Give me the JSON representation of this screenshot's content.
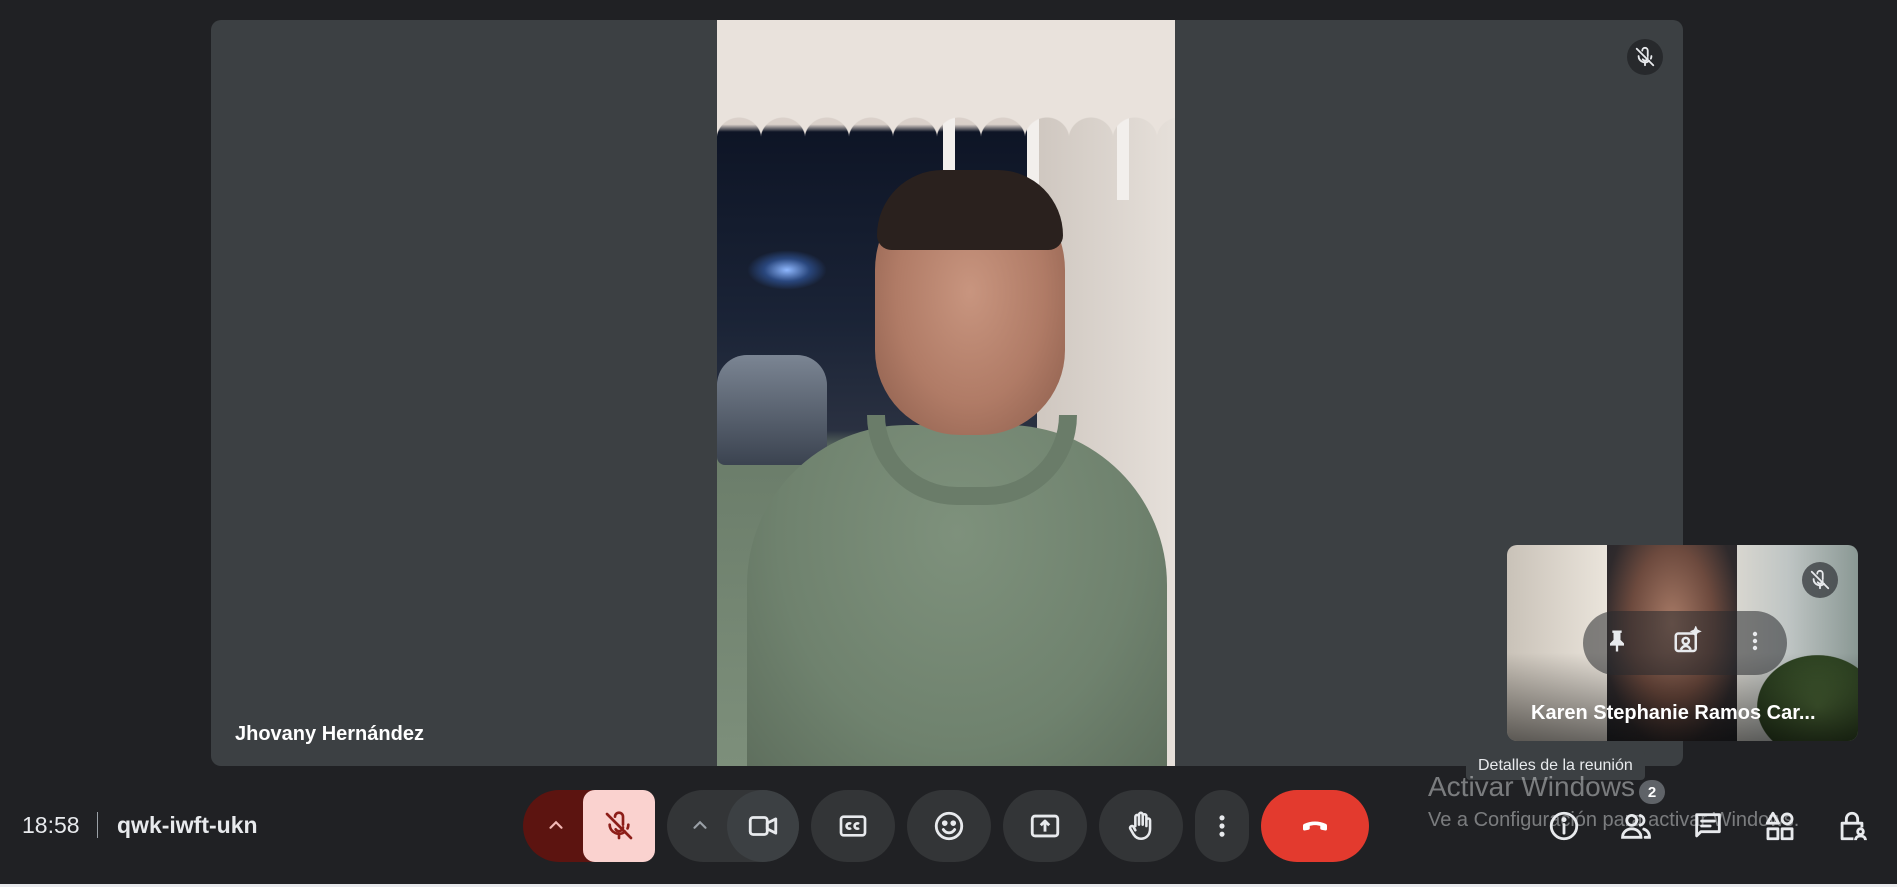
{
  "main_participant": {
    "name": "Jhovany Hernández"
  },
  "self_tile": {
    "name": "Karen Stephanie Ramos Car..."
  },
  "tooltip": {
    "text": "Detalles de la reunión"
  },
  "footer": {
    "time": "18:58",
    "meeting_code": "qwk-iwft-ukn"
  },
  "people_count": "2",
  "watermark": {
    "line1": "Activar Windows",
    "line2": "Ve a Configuración para activar Windows."
  },
  "colors": {
    "background": "#202124",
    "tile": "#3c4043",
    "control_bg": "#333537",
    "mic_off_bg": "#fad2cf",
    "mic_group_bg": "#5c1410",
    "end_call": "#e33a2e"
  },
  "icons": {
    "mic_off": "mic-off-icon",
    "camera": "videocam-icon",
    "captions": "closed-caption-icon",
    "reactions": "emoji-icon",
    "present": "present-screen-icon",
    "raise_hand": "hand-icon",
    "more": "more-vert-icon",
    "end_call": "call-end-icon",
    "info": "info-icon",
    "people": "people-icon",
    "chat": "chat-icon",
    "activities": "activities-icon",
    "host_controls": "lock-person-icon"
  }
}
